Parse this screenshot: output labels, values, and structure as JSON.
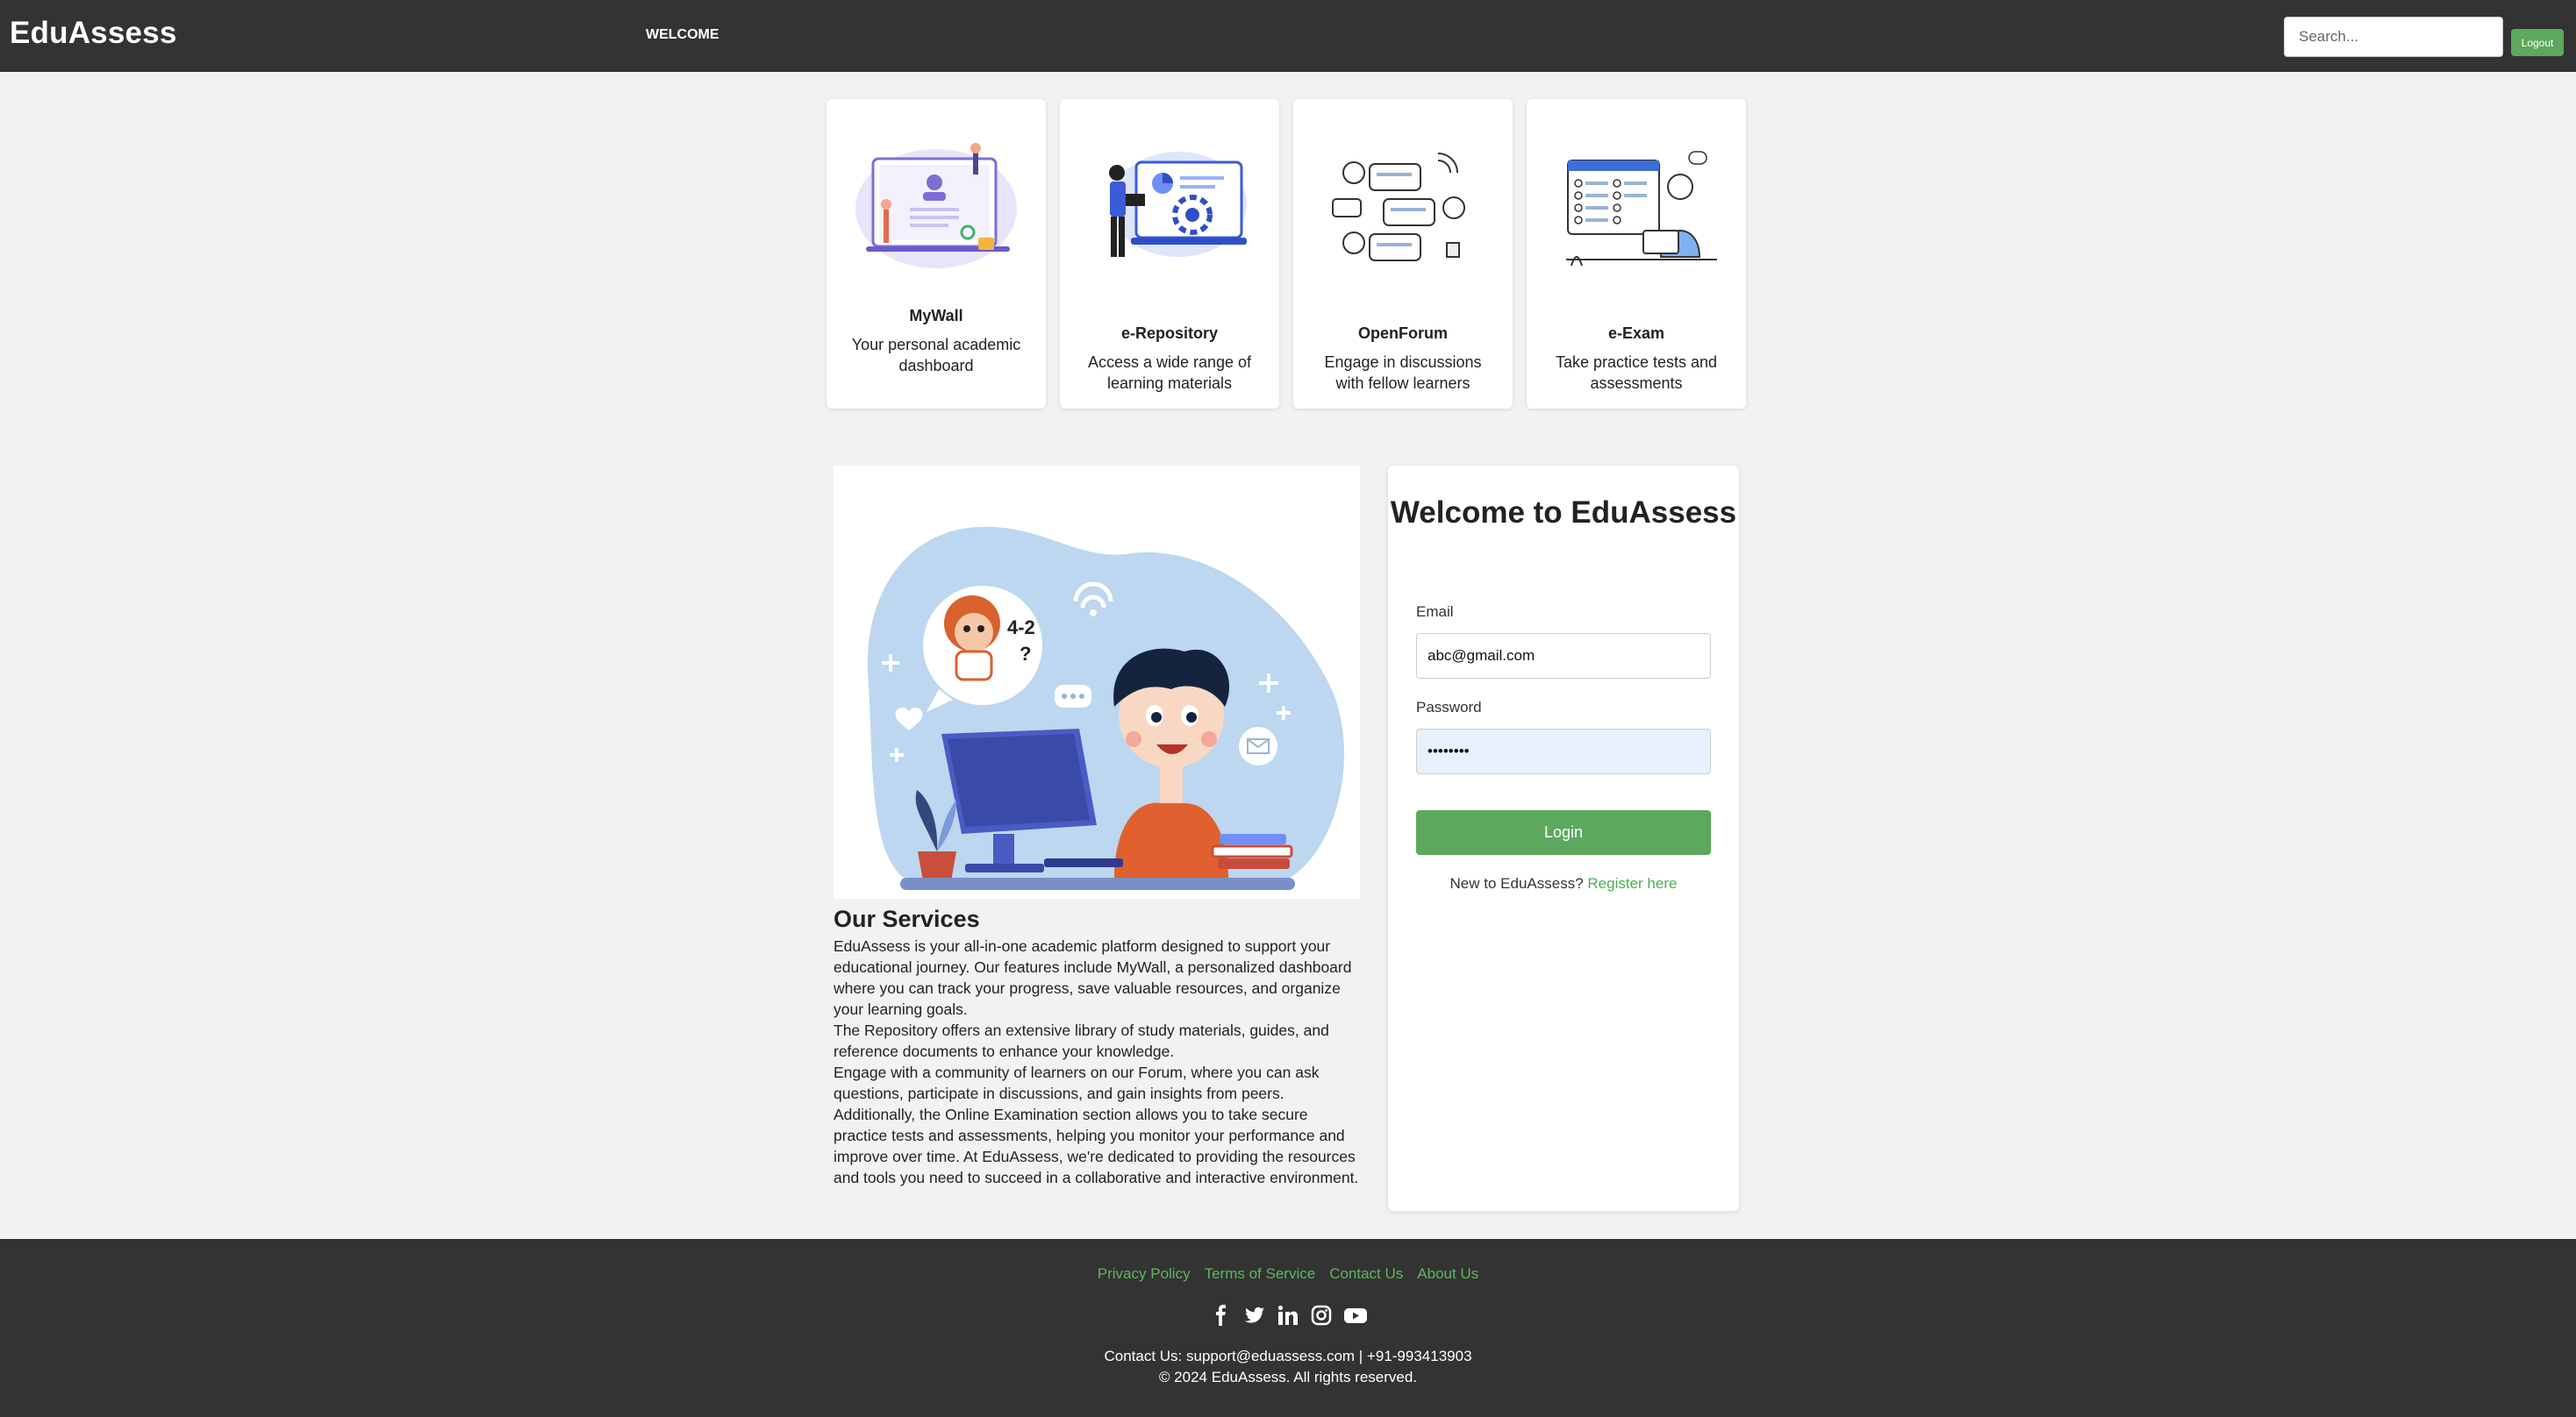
{
  "header": {
    "brand": "EduAssess",
    "nav_welcome": "WELCOME",
    "search_placeholder": "Search...",
    "logout_label": "Logout"
  },
  "features": [
    {
      "title": "MyWall",
      "desc": "Your personal academic dashboard"
    },
    {
      "title": "e-Repository",
      "desc": "Access a wide range of learning materials"
    },
    {
      "title": "OpenForum",
      "desc": "Engage in discussions with fellow learners"
    },
    {
      "title": "e-Exam",
      "desc": "Take practice tests and assessments"
    }
  ],
  "services": {
    "title": "Our Services",
    "text": "EduAssess is your all-in-one academic platform designed to support your educational journey. Our features include MyWall, a personalized dashboard where you can track your progress, save valuable resources, and organize your learning goals.\nThe Repository offers an extensive library of study materials, guides, and reference documents to enhance your knowledge.\nEngage with a community of learners on our Forum, where you can ask questions, participate in discussions, and gain insights from peers. Additionally, the Online Examination section allows you to take secure practice tests and assessments, helping you monitor your performance and improve over time. At EduAssess, we're dedicated to providing the resources and tools you need to succeed in a collaborative and interactive environment."
  },
  "login": {
    "title": "Welcome to EduAssess",
    "email_label": "Email",
    "email_value": "abc@gmail.com",
    "password_label": "Password",
    "password_value": "••••••••",
    "login_button": "Login",
    "register_prompt": "New to EduAssess?",
    "register_link": "Register here"
  },
  "footer": {
    "links": [
      "Privacy Policy",
      "Terms of Service",
      "Contact Us",
      "About Us"
    ],
    "socials": [
      "facebook-icon",
      "twitter-icon",
      "linkedin-icon",
      "instagram-icon",
      "youtube-icon"
    ],
    "contact": "Contact Us: support@eduassess.com | +91-993413903",
    "copyright": "© 2024 EduAssess. All rights reserved."
  },
  "colors": {
    "header_bg": "#333333",
    "accent_green": "#5ca85c",
    "link_green": "#4caf50",
    "page_bg": "#f2f2f2"
  }
}
